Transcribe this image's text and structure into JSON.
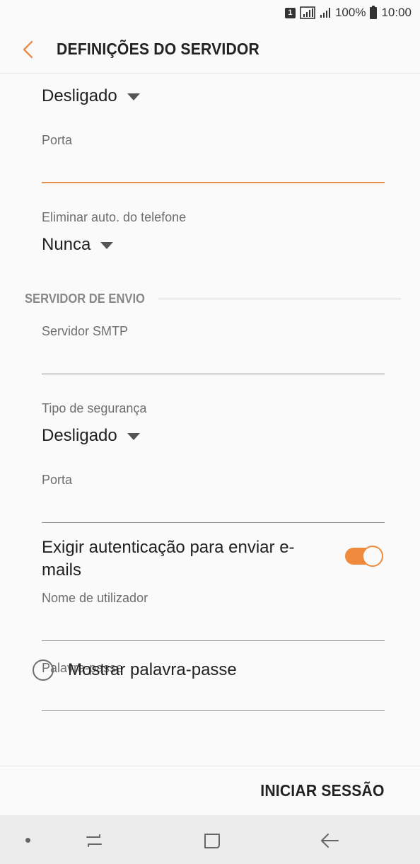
{
  "status_bar": {
    "sim": "1",
    "battery": "100%",
    "time": "10:00"
  },
  "app_bar": {
    "title": "DEFINIÇÕES DO SERVIDOR"
  },
  "incoming": {
    "security_value": "Desligado",
    "port_label": "Porta",
    "port_value": "",
    "auto_delete_label": "Eliminar auto. do telefone",
    "auto_delete_value": "Nunca"
  },
  "outgoing": {
    "section_title": "SERVIDOR DE ENVIO",
    "smtp_label": "Servidor SMTP",
    "smtp_value": "",
    "security_label": "Tipo de segurança",
    "security_value": "Desligado",
    "port_label": "Porta",
    "port_value": "",
    "auth_label": "Exigir autenticação para enviar e-mails",
    "auth_enabled": true,
    "username_label": "Nome de utilizador",
    "username_value": "",
    "password_label": "Palavra-passe",
    "password_value": "",
    "show_password_label": "Mostrar palavra-passe"
  },
  "actions": {
    "login_label": "INICIAR SESSÃO"
  },
  "colors": {
    "accent": "#f08a3c",
    "focus_line": "#ec8c4b",
    "text_primary": "#212121",
    "text_secondary": "#6e6e6e"
  },
  "icons": {
    "back": "chevron-left-icon",
    "recents": "recents-icon",
    "home": "home-icon",
    "nav_back": "arrow-left-icon"
  }
}
